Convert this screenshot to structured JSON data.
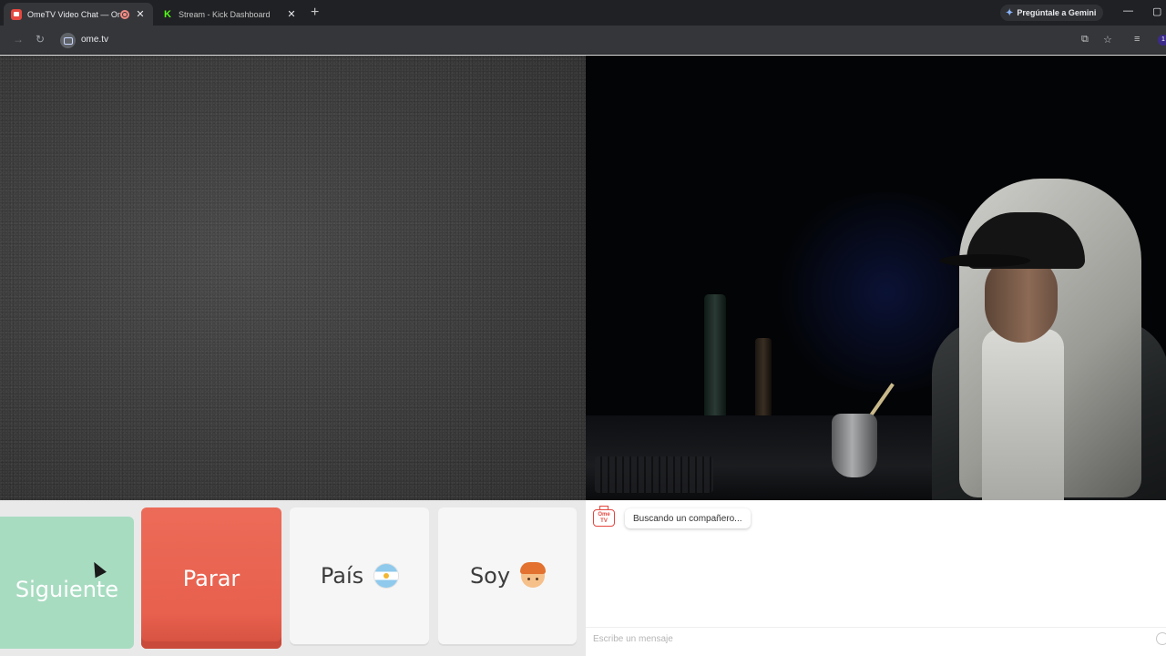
{
  "browser": {
    "tabs": [
      {
        "title": "OmeTV Video Chat — Ome",
        "active": true
      },
      {
        "title": "Stream - Kick Dashboard",
        "active": false
      }
    ],
    "new_tab": "+",
    "gemini_label": "Pregúntale a Gemini",
    "url": "ome.tv",
    "extension_badge": "1"
  },
  "controls": {
    "next_label": "Siguiente",
    "stop_label": "Parar",
    "country_label": "País",
    "gender_label": "Soy"
  },
  "chat": {
    "status": "Buscando un compañero...",
    "input_placeholder": "Escribe un mensaje",
    "logo_text": "Ome TV"
  },
  "colors": {
    "next_button": "#a8dcc1",
    "stop_button": "#e8604e",
    "brand": "#e5473f"
  },
  "icons": [
    "ometv-favicon",
    "kick-favicon",
    "recording-icon",
    "close-icon",
    "gemini-spark-icon",
    "back-icon",
    "reload-icon",
    "cast-icon",
    "star-icon",
    "reading-list-icon",
    "argentina-flag-icon",
    "boy-emoji-icon",
    "emoji-icon"
  ]
}
